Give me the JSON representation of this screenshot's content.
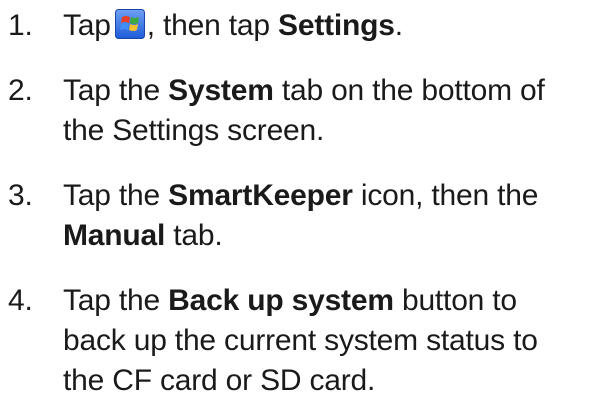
{
  "steps": [
    {
      "number": "1.",
      "pre": "Tap",
      "icon": "windows-start-icon",
      "mid": ", then tap",
      "bold": "Settings",
      "post": "."
    },
    {
      "number": "2.",
      "pre": "Tap the",
      "bold": "System",
      "post_line1": "tab on the bottom of",
      "line2": "the Settings screen."
    },
    {
      "number": "3.",
      "pre": "Tap the",
      "bold": "SmartKeeper",
      "post_line1": "icon, then the",
      "bold2": "Manual",
      "post_line2": "tab."
    },
    {
      "number": "4.",
      "pre": "Tap the",
      "bold": "Back up system",
      "post_line1": "button to",
      "line2": "back up the current system status to",
      "line3": "the CF card or SD card."
    }
  ],
  "colors": {
    "text": "#1a1a1a",
    "icon_blue": "#1e5bd8",
    "icon_red": "#e8402a",
    "icon_green": "#3caa3c",
    "icon_yellow": "#f2c12e"
  }
}
